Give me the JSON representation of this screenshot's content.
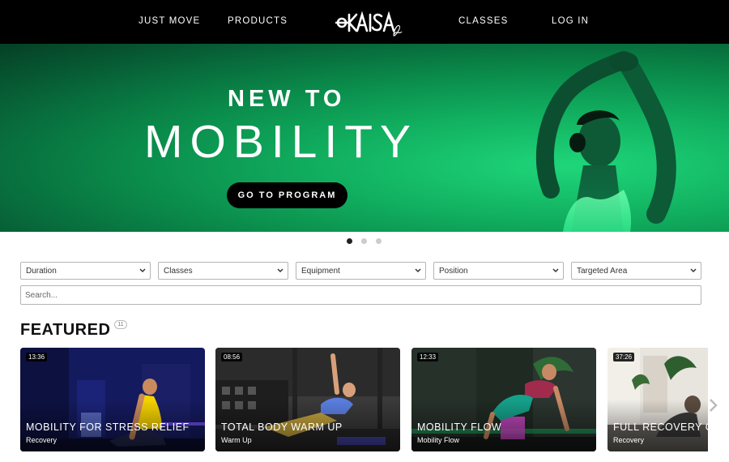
{
  "nav": {
    "items": [
      "JUST MOVE",
      "PRODUCTS",
      "CLASSES",
      "LOG IN"
    ],
    "logo_text": "KAISA"
  },
  "hero": {
    "superline": "NEW TO",
    "title": "MOBILITY",
    "button": "GO TO PROGRAM",
    "slides_total": 3,
    "active_slide": 1
  },
  "filters": {
    "selects": [
      "Duration",
      "Classes",
      "Equipment",
      "Position",
      "Targeted Area"
    ],
    "search_placeholder": "Search..."
  },
  "featured": {
    "title": "FEATURED",
    "count": "11",
    "cards": [
      {
        "duration": "13:36",
        "title": "MOBILITY FOR STRESS RELIEF",
        "category": "Recovery",
        "theme": "blue"
      },
      {
        "duration": "08:56",
        "title": "TOTAL BODY WARM UP",
        "category": "Warm Up",
        "theme": "gym"
      },
      {
        "duration": "12:33",
        "title": "MOBILITY FLOW",
        "category": "Mobility Flow",
        "theme": "green"
      },
      {
        "duration": "37:26",
        "title": "FULL RECOVERY C",
        "category": "Recovery",
        "theme": "home"
      }
    ]
  },
  "colors": {
    "nav_bg": "#000000",
    "hero_green": "#0a8a4a",
    "button_bg": "#000000"
  },
  "icons": [
    "chevron-down-icon",
    "chevron-right-icon"
  ]
}
